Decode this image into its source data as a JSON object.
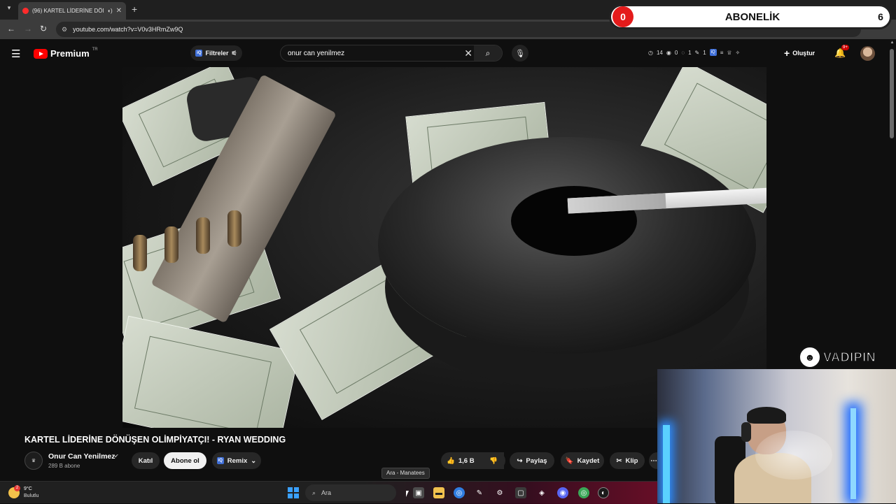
{
  "browser": {
    "tab_title": "(96) KARTEL LİDERİNE DÖN",
    "url": "youtube.com/watch?v=V0v3HRmZw9Q"
  },
  "overlay": {
    "left_count": "0",
    "label": "ABONELİK",
    "right_count": "6"
  },
  "header": {
    "brand": "Premium",
    "region": "TR",
    "filters_label": "Filtreler",
    "search_value": "onur can yenilmez",
    "stats": [
      "14",
      "0",
      "1",
      "1"
    ],
    "create_label": "Oluştur",
    "notif_badge": "9+"
  },
  "video": {
    "title": "KARTEL LİDERİNE DÖNÜŞEN OLİMPİYATÇI! - RYAN WEDDING"
  },
  "channel": {
    "name": "Onur Can Yenilmez",
    "subscribers": "289 B abone",
    "join_label": "Katıl",
    "subscribe_label": "Abone ol",
    "remix_label": "Remix"
  },
  "actions": {
    "likes": "1,6 B",
    "share_label": "Paylaş",
    "save_label": "Kaydet",
    "clip_label": "Klip"
  },
  "logo_overlay": {
    "word": "VADIPIN"
  },
  "taskbar": {
    "temperature": "9°C",
    "weather_desc": "Bulutlu",
    "weather_alert": "2",
    "search_label": "Ara",
    "tooltip": "Ara - Manatees"
  }
}
